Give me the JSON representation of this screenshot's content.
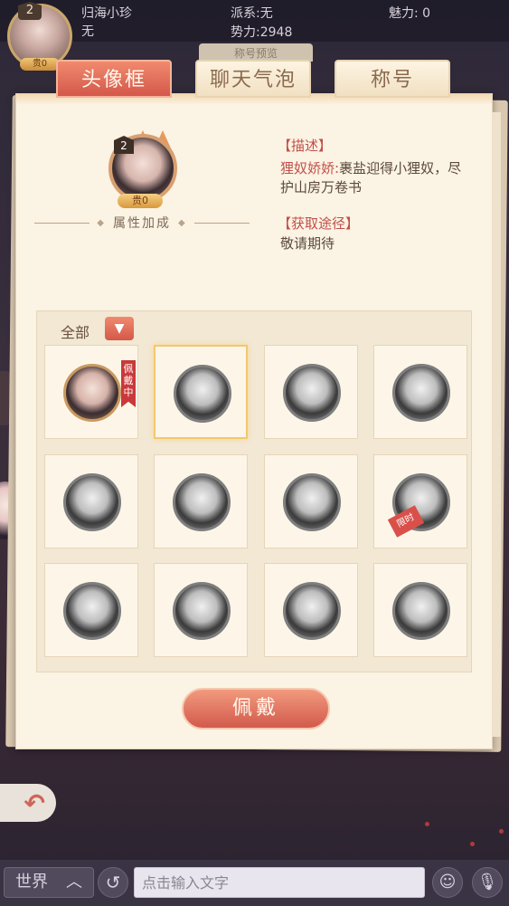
{
  "player": {
    "name": "归海小珍",
    "sub": "无",
    "faction": "派系:无",
    "power": "势力:2948",
    "charm": "魅力: 0",
    "level": "2",
    "vip": "贵0"
  },
  "hidden_tab": "称号预览",
  "tabs": [
    {
      "label": "头像框"
    },
    {
      "label": "聊天气泡"
    },
    {
      "label": "称号"
    }
  ],
  "preview": {
    "level": "2",
    "vip": "贵0",
    "attr_title": "属性加成"
  },
  "description": {
    "heading": "【描述】",
    "name": "狸奴娇娇:",
    "text": "裹盐迎得小狸奴，尽护山房万卷书",
    "obtain_heading": "【获取途径】",
    "obtain_text": "敬请期待"
  },
  "filter": {
    "label": "全部",
    "icon": "chevron-down-icon"
  },
  "badges": {
    "wearing": "佩戴中",
    "limited": "限时"
  },
  "equip_label": "佩戴",
  "chat": {
    "channel": "世界",
    "placeholder": "点击输入文字"
  },
  "colors": {
    "accent": "#d4584a",
    "panel": "#fbf3e3",
    "backdrop": "#2d2838"
  }
}
